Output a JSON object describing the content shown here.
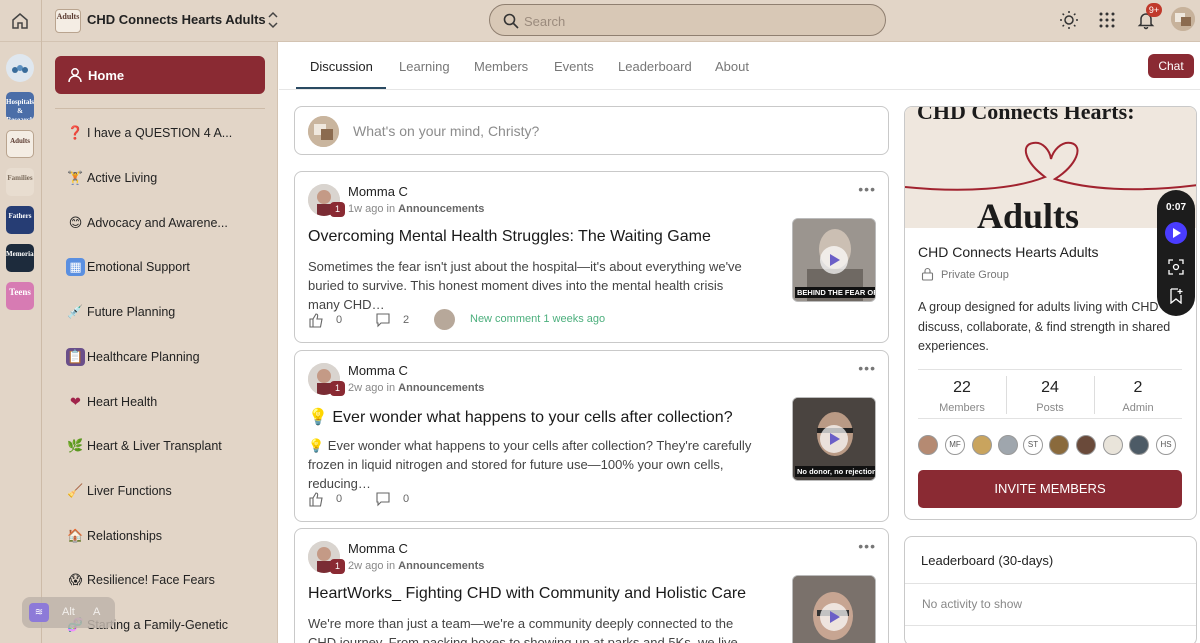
{
  "topbar": {
    "group_thumb_text": "Adults",
    "group_name": "CHD Connects Hearts Adults",
    "search_placeholder": "Search",
    "notification_count": "9+"
  },
  "rail": {
    "items": [
      {
        "label": "",
        "bg": "#dfe7ef",
        "color": "#3a6c9a"
      },
      {
        "label": "Hospitals & Research",
        "bg": "#4b6ea8",
        "color": "#ffffff"
      },
      {
        "label": "Adults",
        "bg": "#f4ede4",
        "color": "#5a3a30"
      },
      {
        "label": "Families",
        "bg": "#e8ddd0",
        "color": "#7a6a5a"
      },
      {
        "label": "Fathers",
        "bg": "#263d74",
        "color": "#ffffff"
      },
      {
        "label": "Memorial",
        "bg": "#1d2b3c",
        "color": "#ffffff"
      },
      {
        "label": "Teens",
        "bg": "#d77bb3",
        "color": "#ffffff"
      }
    ]
  },
  "sidebar": {
    "home_label": "Home",
    "items": [
      {
        "emoji": "❓",
        "label": "I have a QUESTION 4 A..."
      },
      {
        "emoji": "🏋",
        "label": "Active Living"
      },
      {
        "emoji": "😊",
        "label": "Advocacy and Awarene..."
      },
      {
        "emoji": "▦",
        "label": "Emotional Support"
      },
      {
        "emoji": "💉",
        "label": "Future Planning"
      },
      {
        "emoji": "📋",
        "label": "Healthcare Planning"
      },
      {
        "emoji": "❤",
        "label": "Heart Health"
      },
      {
        "emoji": "🌿",
        "label": "Heart & Liver Transplant"
      },
      {
        "emoji": "🧹",
        "label": "Liver Functions"
      },
      {
        "emoji": "🏠",
        "label": "Relationships"
      },
      {
        "emoji": "😱",
        "label": "Resilience! Face Fears"
      },
      {
        "emoji": "🧬",
        "label": "Starting a Family-Genetic"
      }
    ]
  },
  "tabs": [
    "Discussion",
    "Learning",
    "Members",
    "Events",
    "Leaderboard",
    "About"
  ],
  "chat_label": "Chat",
  "composer": {
    "placeholder": "What's on your mind, Christy?"
  },
  "posts": [
    {
      "author": "Momma C",
      "time": "1w ago",
      "in": "in",
      "category": "Announcements",
      "level": "1",
      "title": "Overcoming Mental Health Struggles: The Waiting Game",
      "excerpt": "Sometimes the fear isn't just about the hospital—it's about everything we've buried to survive. This honest moment dives into the mental health crisis many CHD…",
      "likes": "0",
      "comments": "2",
      "new_comment": "New comment 1 weeks ago",
      "thumb_caption": "BEHIND THE FEAR OF",
      "thumb_bg": "#8f8a85"
    },
    {
      "author": "Momma C",
      "time": "2w ago",
      "in": "in",
      "category": "Announcements",
      "level": "1",
      "title": "💡  Ever wonder what happens to your cells after collection?",
      "excerpt": "💡  Ever wonder what happens to your cells after collection? They're carefully frozen in liquid nitrogen and stored for future use—100% your own cells, reducing…",
      "likes": "0",
      "comments": "0",
      "new_comment": "",
      "thumb_caption": "No donor, no rejection—",
      "thumb_bg": "#3a3633"
    },
    {
      "author": "Momma C",
      "time": "2w ago",
      "in": "in",
      "category": "Announcements",
      "level": "1",
      "title": "HeartWorks_ Fighting CHD with Community and Holistic Care",
      "excerpt": "We're more than just a team—we're a community deeply connected to the CHD journey. From packing boxes to showing up at parks and 5Ks, we live the holistic…",
      "likes": "",
      "comments": "",
      "new_comment": "",
      "thumb_caption": "",
      "thumb_bg": "#6d6560"
    }
  ],
  "group_card": {
    "banner_title": "CHD Connects Hearts:",
    "banner_word": "Adults",
    "name": "CHD Connects Hearts Adults",
    "privacy": "Private Group",
    "description": "A group designed for adults living with CHD to discuss, collaborate, & find strength in shared experiences.",
    "stats": [
      {
        "value": "22",
        "label": "Members"
      },
      {
        "value": "24",
        "label": "Posts"
      },
      {
        "value": "2",
        "label": "Admin"
      }
    ],
    "member_avatars": [
      {
        "initials": "",
        "bg": "#b58a72"
      },
      {
        "initials": "MF",
        "bg": "#ffffff"
      },
      {
        "initials": "",
        "bg": "#c9a45e"
      },
      {
        "initials": "",
        "bg": "#9fa6ad"
      },
      {
        "initials": "ST",
        "bg": "#ffffff"
      },
      {
        "initials": "",
        "bg": "#8a6a3c"
      },
      {
        "initials": "",
        "bg": "#6a4a3a"
      },
      {
        "initials": "",
        "bg": "#e9e4da"
      },
      {
        "initials": "",
        "bg": "#4d5b66"
      },
      {
        "initials": "HS",
        "bg": "#ffffff"
      }
    ],
    "invite_label": "INVITE MEMBERS"
  },
  "leaderboard": {
    "title": "Leaderboard (30-days)",
    "empty": "No activity to show"
  },
  "recorder": {
    "time": "0:07"
  },
  "alt_pill": {
    "label": "Alt",
    "key": "A"
  },
  "colors": {
    "accent": "#8a2a33",
    "sidebar_bg": "#e2d5c7",
    "new_comment": "#4caf7d"
  }
}
